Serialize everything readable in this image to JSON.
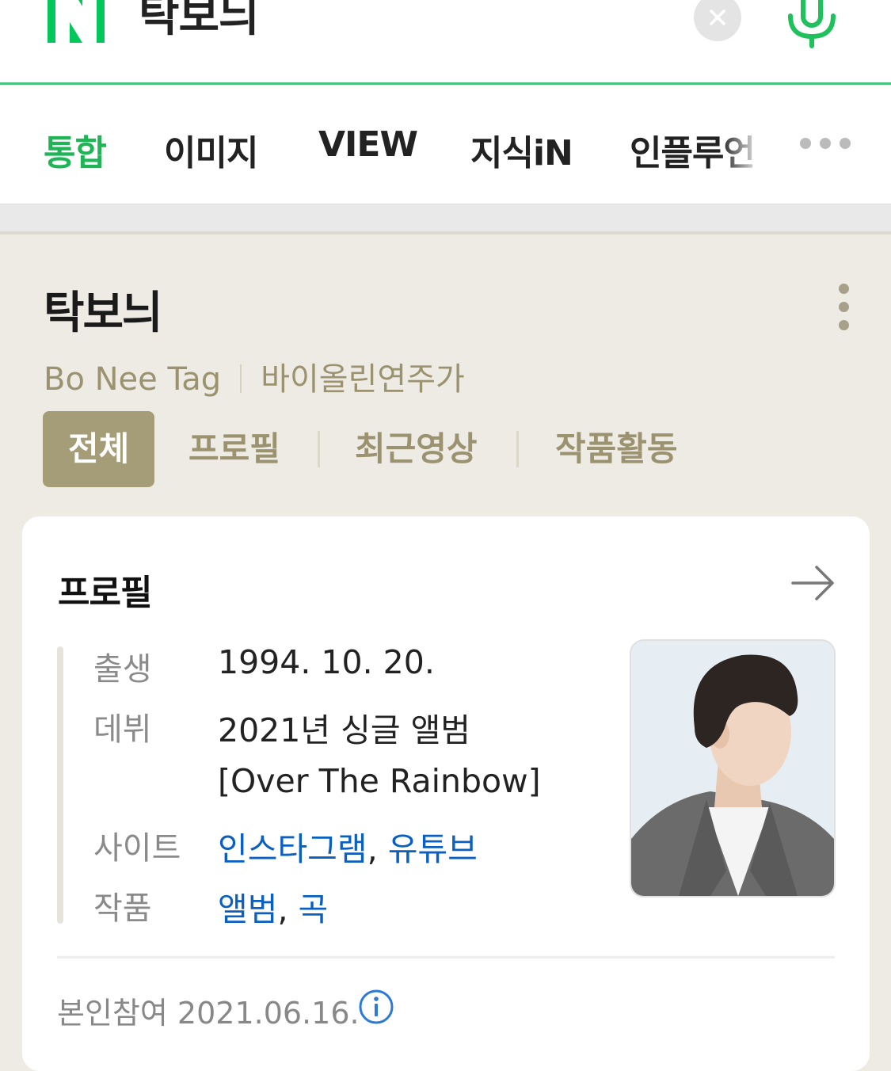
{
  "search": {
    "query": "탁보늬",
    "logo_letter": "N"
  },
  "tabs": [
    {
      "label": "통합",
      "active": true
    },
    {
      "label": "이미지"
    },
    {
      "label": "VIEW"
    },
    {
      "label": "지식iN"
    },
    {
      "label": "인플루언"
    }
  ],
  "person": {
    "name": "탁보늬",
    "english_name": "Bo Nee Tag",
    "occupation": "바이올린연주가"
  },
  "person_tabs": [
    {
      "label": "전체",
      "active": true
    },
    {
      "label": "프로필"
    },
    {
      "label": "최근영상"
    },
    {
      "label": "작품활동"
    }
  ],
  "profile": {
    "title": "프로필",
    "birth_label": "출생",
    "birth_value": "1994. 10. 20.",
    "debut_label": "데뷔",
    "debut_value_line1": "2021년 싱글 앨범",
    "debut_value_line2": "[Over The Rainbow]",
    "site_label": "사이트",
    "site_links": [
      "인스타그램",
      "유튜브"
    ],
    "works_label": "작품",
    "works_links": [
      "앨범",
      "곡"
    ],
    "separator": ",",
    "footer": "본인참여 2021.06.16."
  },
  "colors": {
    "naver_green": "#03c75a",
    "brand_tan": "#a59d77",
    "link_blue": "#0b5fbf"
  },
  "icons": [
    "close-icon",
    "mic-icon",
    "more-dots-icon",
    "kebab-icon",
    "arrow-right-icon",
    "info-icon"
  ]
}
